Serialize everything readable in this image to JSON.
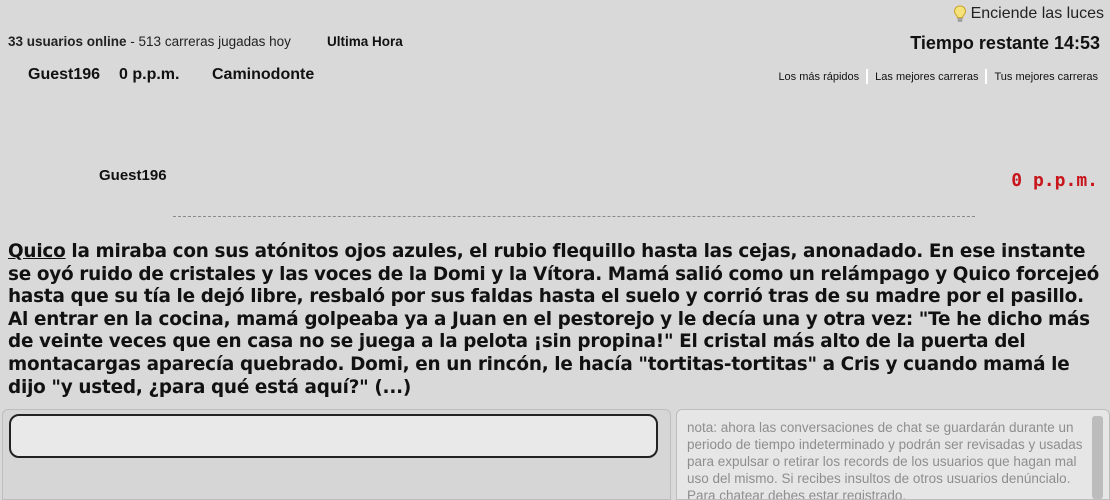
{
  "header": {
    "lights_label": "Enciende las luces",
    "users_online": "33 usuarios online",
    "races_today": " - 513 carreras jugadas hoy",
    "news_label": "Ultima Hora",
    "time_remaining": "Tiempo restante 14:53"
  },
  "player_row": {
    "name": "Guest196",
    "ppm": "0 p.p.m.",
    "author": "Caminodonte"
  },
  "links": [
    "Los más rápidos",
    "Las mejores carreras",
    "Tus mejores carreras"
  ],
  "track": {
    "player": "Guest196",
    "speed": "0 p.p.m."
  },
  "text": {
    "current_word": "Quico",
    "rest": " la miraba con sus atónitos ojos azules, el rubio flequillo hasta las cejas, anonadado. En ese instante se oyó ruido de cristales y las voces de la Domi y la Vítora. Mamá salió como un relámpago y Quico forcejeó hasta que su tía le dejó libre, resbaló por sus faldas hasta el suelo y corrió tras de su madre por el pasillo. Al entrar en la cocina, mamá golpeaba ya a Juan en el pestorejo y le decía una y otra vez: \"Te he dicho más de veinte veces que en casa no se juega a la pelota ¡sin propina!\" El cristal más alto de la puerta del montacargas aparecía quebrado. Domi, en un rincón, le hacía \"tortitas-tortitas\" a Cris y cuando mamá le dijo \"y usted, ¿para qué está aquí?\" (...)"
  },
  "input": {
    "value": ""
  },
  "chat": {
    "note": "nota: ahora las conversaciones de chat se guardarán durante un periodo de tiempo indeterminado y podrán ser revisadas y usadas para expulsar o retirar los records de los usuarios que hagan mal uso del mismo. Si recibes insultos de otros usuarios denúncialo. Para chatear debes estar registrado."
  },
  "colors": {
    "background": "#d9d9d9",
    "speed": "#c8161d",
    "note": "#8e8e8e"
  },
  "icons": {
    "lights": "lightbulb-icon"
  }
}
